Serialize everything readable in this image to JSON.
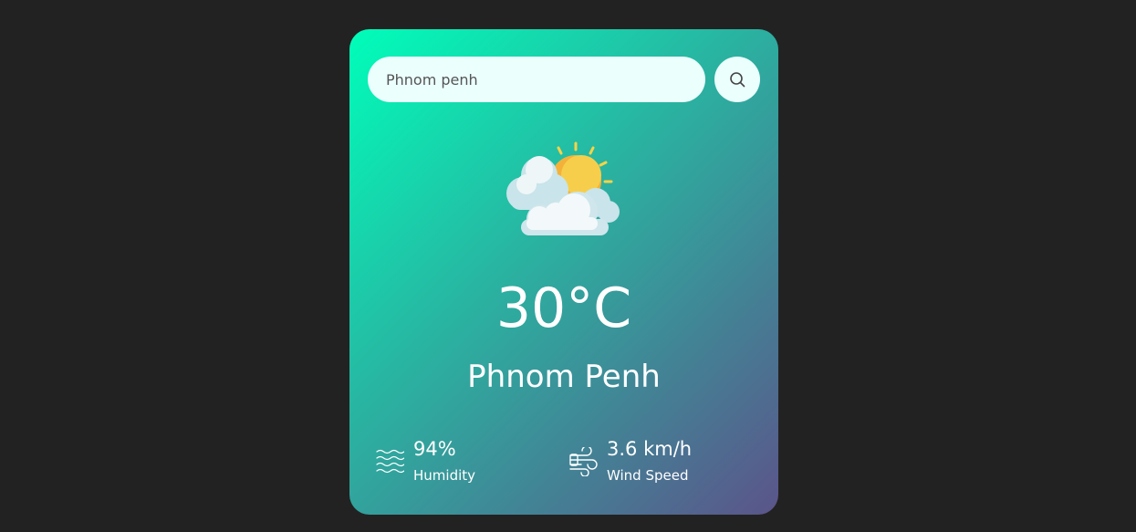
{
  "search": {
    "value": "Phnom penh",
    "placeholder": "enter city name"
  },
  "weather": {
    "icon": "sun-behind-clouds-icon",
    "temperature": "30°C",
    "city": "Phnom Penh"
  },
  "details": {
    "humidity": {
      "value": "94%",
      "label": "Humidity",
      "icon": "humidity-waves-icon"
    },
    "wind": {
      "value": "3.6 km/h",
      "label": "Wind Speed",
      "icon": "wind-icon"
    }
  },
  "colors": {
    "background": "#222222",
    "card_gradient_start": "#00feba",
    "card_gradient_end": "#5b548a",
    "input_background": "#ebfffc",
    "text": "#ffffff"
  }
}
